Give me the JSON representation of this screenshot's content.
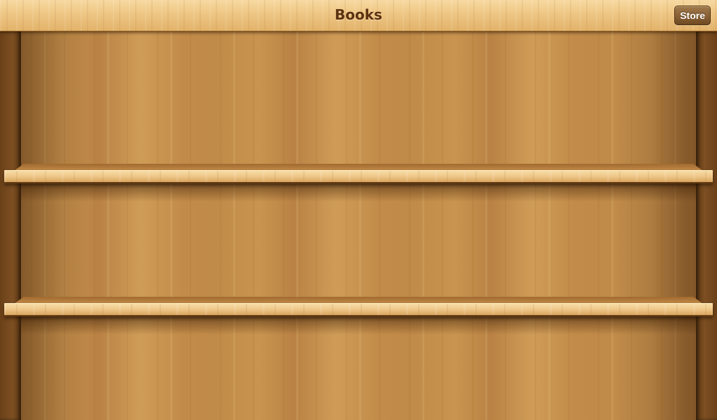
{
  "header": {
    "title": "Books",
    "store_button_label": "Store"
  },
  "bookshelf": {
    "shelf_count": 2,
    "colors": {
      "wood_light": "#eec688",
      "wood_mid": "#c38d4b",
      "wood_dark": "#6b4118",
      "title_text": "#5c3110",
      "button_bg": "#8a6236"
    }
  }
}
